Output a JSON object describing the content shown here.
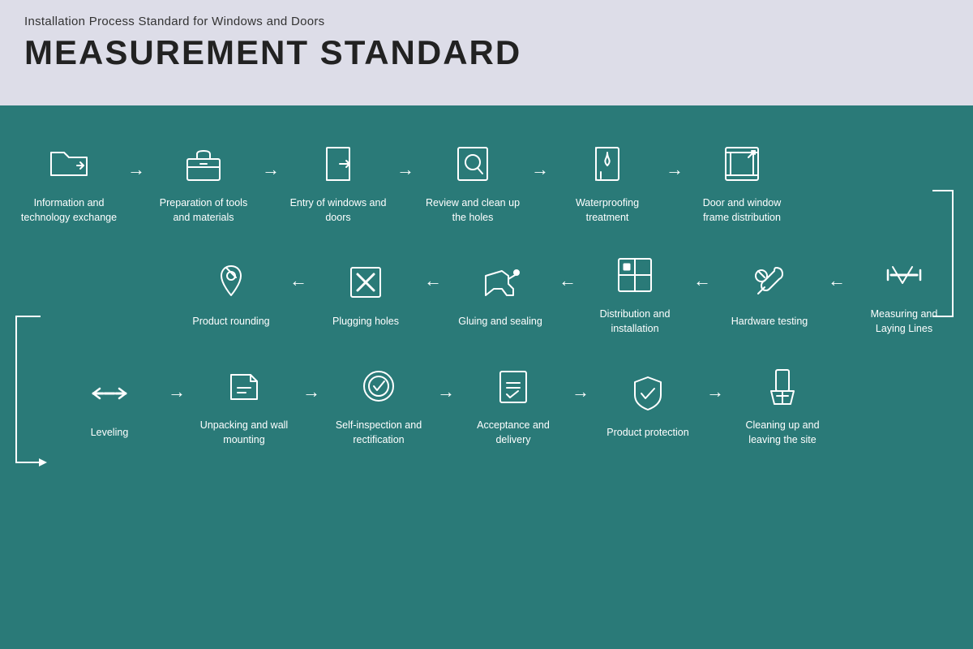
{
  "header": {
    "subtitle": "Installation Process Standard for Windows and Doors",
    "title": "MEASUREMENT STANDARD"
  },
  "row1": [
    {
      "id": "info-exchange",
      "label": "Information and technology exchange",
      "icon": "folder-share"
    },
    {
      "id": "tools-prep",
      "label": "Preparation of tools and materials",
      "icon": "toolbox"
    },
    {
      "id": "entry-windows",
      "label": "Entry of windows and doors",
      "icon": "door-entry"
    },
    {
      "id": "review-holes",
      "label": "Review and clean up the holes",
      "icon": "magnify"
    },
    {
      "id": "waterproofing",
      "label": "Waterproofing treatment",
      "icon": "waterproof"
    },
    {
      "id": "frame-dist",
      "label": "Door and window frame distribution",
      "icon": "frame-dist"
    }
  ],
  "row2": [
    {
      "id": "measuring",
      "label": "Measuring and Laying Lines",
      "icon": "measure"
    },
    {
      "id": "hardware",
      "label": "Hardware testing",
      "icon": "wrench"
    },
    {
      "id": "distribution",
      "label": "Distribution and installation",
      "icon": "grid-install"
    },
    {
      "id": "gluing",
      "label": "Gluing and sealing",
      "icon": "glue-gun"
    },
    {
      "id": "plugging",
      "label": "Plugging holes",
      "icon": "plug-hole"
    },
    {
      "id": "rounding",
      "label": "Product rounding",
      "icon": "pin"
    }
  ],
  "row3": [
    {
      "id": "leveling",
      "label": "Leveling",
      "icon": "level"
    },
    {
      "id": "unpacking",
      "label": "Unpacking and wall mounting",
      "icon": "unpack"
    },
    {
      "id": "self-inspect",
      "label": "Self-inspection and rectification",
      "icon": "inspect"
    },
    {
      "id": "acceptance",
      "label": "Acceptance and delivery",
      "icon": "accept"
    },
    {
      "id": "protection",
      "label": "Product protection",
      "icon": "shield"
    },
    {
      "id": "cleanup",
      "label": "Cleaning up and leaving the site",
      "icon": "broom"
    }
  ]
}
